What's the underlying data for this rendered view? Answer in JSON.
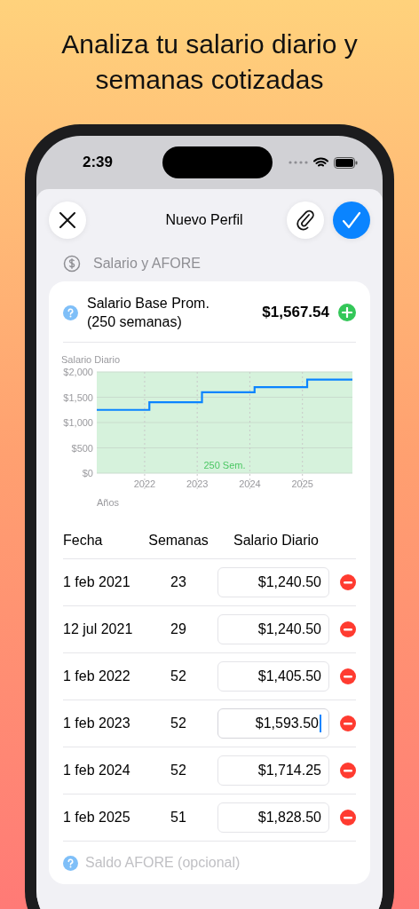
{
  "headline": "Analiza tu salario diario y semanas cotizadas",
  "status_bar": {
    "time": "2:39"
  },
  "sheet": {
    "title": "Nuevo Perfil"
  },
  "section": {
    "label": "Salario y AFORE"
  },
  "summary": {
    "label": "Salario Base Prom. (250 semanas)",
    "value": "$1,567.54"
  },
  "chart": {
    "chart_data": {
      "type": "line",
      "ylabel": "Salario Diario",
      "xlabel": "Años",
      "x": [
        2021.09,
        2022.09,
        2022.09,
        2023.09,
        2023.09,
        2024.09,
        2024.09,
        2025.09,
        2025.09,
        2025.95
      ],
      "values": [
        1250,
        1250,
        1400,
        1400,
        1600,
        1600,
        1700,
        1700,
        1850,
        1850
      ],
      "xlim": [
        2021.09,
        2025.95
      ],
      "grid": true,
      "ylim": [
        0,
        2000
      ],
      "xticks": [
        2022,
        2023,
        2024,
        2025
      ],
      "yticks": [
        {
          "value": 0,
          "label": "$0"
        },
        {
          "value": 500,
          "label": "$500"
        },
        {
          "value": 1000,
          "label": "$1,000"
        },
        {
          "value": 1500,
          "label": "$1,500"
        },
        {
          "value": 2000,
          "label": "$2,000"
        }
      ],
      "annotations": [
        {
          "text": "250 Sem."
        }
      ]
    }
  },
  "table": {
    "columns": [
      "Fecha",
      "Semanas",
      "Salario Diario"
    ],
    "rows": [
      {
        "date": "1 feb 2021",
        "weeks": "23",
        "salary": "$1,240.50",
        "focused": false
      },
      {
        "date": "12 jul 2021",
        "weeks": "29",
        "salary": "$1,240.50",
        "focused": false
      },
      {
        "date": "1 feb 2022",
        "weeks": "52",
        "salary": "$1,405.50",
        "focused": false
      },
      {
        "date": "1 feb 2023",
        "weeks": "52",
        "salary": "$1,593.50",
        "focused": true
      },
      {
        "date": "1 feb 2024",
        "weeks": "52",
        "salary": "$1,714.25",
        "focused": false
      },
      {
        "date": "1 feb 2025",
        "weeks": "51",
        "salary": "$1,828.50",
        "focused": false
      }
    ]
  },
  "afore": {
    "placeholder": "Saldo AFORE (opcional)"
  }
}
